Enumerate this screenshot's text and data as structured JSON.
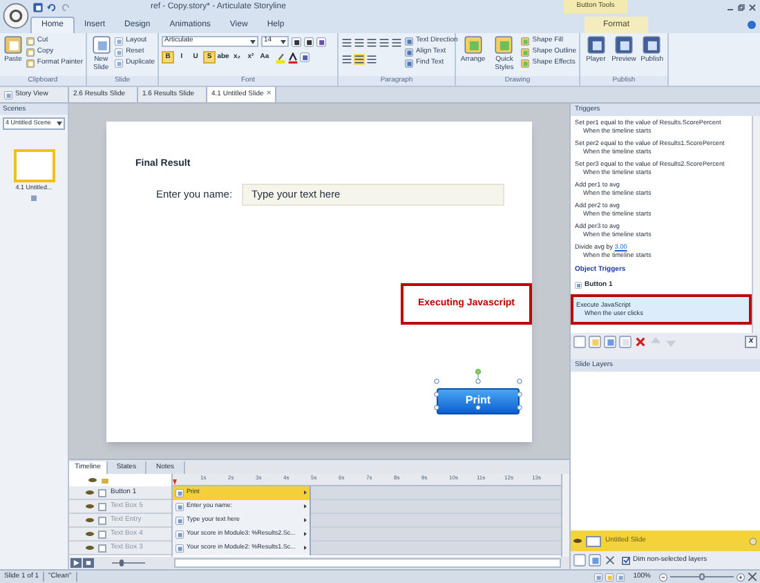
{
  "window": {
    "title": "ref - Copy.story* - Articulate Storyline",
    "context_group": "Button Tools"
  },
  "ribbon_tabs": [
    {
      "label": "Home",
      "selected": true,
      "contextual": false
    },
    {
      "label": "Insert",
      "selected": false,
      "contextual": false
    },
    {
      "label": "Design",
      "selected": false,
      "contextual": false
    },
    {
      "label": "Animations",
      "selected": false,
      "contextual": false
    },
    {
      "label": "View",
      "selected": false,
      "contextual": false
    },
    {
      "label": "Help",
      "selected": false,
      "contextual": false
    },
    {
      "label": "Format",
      "selected": false,
      "contextual": true
    }
  ],
  "ribbon_groups": [
    {
      "label": "Clipboard",
      "kind": "commands",
      "commands": [
        {
          "label": "Paste",
          "kind": "large"
        },
        {
          "label": "Cut",
          "kind": "small"
        },
        {
          "label": "Copy",
          "kind": "small"
        },
        {
          "label": "Format Painter",
          "kind": "small"
        }
      ]
    },
    {
      "label": "Slide",
      "kind": "commands",
      "commands": [
        {
          "label": "New Slide",
          "kind": "large"
        },
        {
          "label": "Layout",
          "kind": "small"
        },
        {
          "label": "Reset",
          "kind": "small"
        },
        {
          "label": "Duplicate",
          "kind": "small"
        }
      ]
    },
    {
      "label": "Font",
      "kind": "font",
      "font_name": "Articulate",
      "font_size": "14",
      "format_buttons": [
        {
          "label": "B",
          "selected": true
        },
        {
          "label": "I",
          "selected": false
        },
        {
          "label": "U",
          "selected": false
        },
        {
          "label": "S",
          "selected": true
        },
        {
          "label": "abe",
          "selected": false
        },
        {
          "label": "x₂",
          "selected": false
        },
        {
          "label": "x²",
          "selected": false
        },
        {
          "label": "Aa",
          "selected": false
        }
      ]
    },
    {
      "label": "Paragraph",
      "kind": "paragraph",
      "commands": [
        {
          "label": "Text Direction",
          "kind": "small"
        },
        {
          "label": "Align Text",
          "kind": "small"
        },
        {
          "label": "Find Text",
          "kind": "small"
        }
      ]
    },
    {
      "label": "Drawing",
      "kind": "commands",
      "commands": [
        {
          "label": "Arrange",
          "kind": "large"
        },
        {
          "label": "Quick Styles",
          "kind": "large"
        },
        {
          "label": "Shape Fill",
          "kind": "small"
        },
        {
          "label": "Shape Outline",
          "kind": "small"
        },
        {
          "label": "Shape Effects",
          "kind": "small"
        }
      ]
    },
    {
      "label": "Publish",
      "kind": "commands",
      "commands": [
        {
          "label": "Player",
          "kind": "large"
        },
        {
          "label": "Preview",
          "kind": "large"
        },
        {
          "label": "Publish",
          "kind": "large"
        }
      ]
    }
  ],
  "document_tabs": [
    {
      "label": "Story View",
      "kind": "story",
      "selected": false
    },
    {
      "label": "2.6 Results Slide",
      "kind": "slide",
      "selected": false
    },
    {
      "label": "1.6 Results Slide",
      "kind": "slide",
      "selected": false
    },
    {
      "label": "4.1 Untitled Slide",
      "kind": "slide",
      "selected": true,
      "close": "×"
    }
  ],
  "scenes": {
    "title": "Scenes",
    "scene": "4 Untitled Scene",
    "slides": [
      {
        "label": "4.1 Untitled...",
        "selected": true
      }
    ]
  },
  "slide": {
    "heading": "Final Result",
    "entry_label": "Enter you name:",
    "entry_text": "Type your text here",
    "button": {
      "label": "Print",
      "selected": true
    }
  },
  "callout": "Executing Javascript",
  "timeline": {
    "tabs": [
      {
        "label": "Timeline",
        "selected": true
      },
      {
        "label": "States",
        "selected": false
      },
      {
        "label": "Notes",
        "selected": false
      }
    ],
    "ruler": [
      "1s",
      "2s",
      "3s",
      "4s",
      "5s",
      "6s",
      "7s",
      "8s",
      "9s",
      "10s",
      "11s",
      "12s",
      "13s"
    ],
    "rows": [
      {
        "name": "Button 1",
        "object": "Print",
        "selected": true,
        "locked": false
      },
      {
        "name": "Text Box 5",
        "object": "Enter you name:",
        "selected": false,
        "locked": false
      },
      {
        "name": "Text Entry",
        "object": "Type your text here",
        "selected": false,
        "locked": false
      },
      {
        "name": "Text Box 4",
        "object": "Your score in Module3: %Results2.Sc...",
        "selected": false,
        "locked": false
      },
      {
        "name": "Text Box 3",
        "object": "Your score in Module2: %Results1.Sc...",
        "selected": false,
        "locked": false
      }
    ],
    "zoom_slider": {
      "level": 0.3
    }
  },
  "triggers": {
    "title": "Triggers",
    "items": [
      {
        "action": "Set per1 equal to the value of Results.ScorePercent",
        "condition": "When the timeline starts"
      },
      {
        "action": "Set per2 equal to the value of Results1.ScorePercent",
        "condition": "When the timeline starts"
      },
      {
        "action": "Set per3 equal to the value of Results2.ScorePercent",
        "condition": "When the timeline starts"
      },
      {
        "action": "Add per1 to avg",
        "condition": "When the timeline starts"
      },
      {
        "action": "Add per2 to avg",
        "condition": "When the timeline starts"
      },
      {
        "action": "Add per3 to avg",
        "condition": "When the timeline starts"
      },
      {
        "action": "Divide avg by",
        "link": "3.00",
        "condition": "When the timeline starts"
      }
    ],
    "object_section": "Object Triggers",
    "object": "Button 1",
    "object_items": [
      {
        "action": "Execute JavaScript",
        "condition": "When the user clicks",
        "selected": true,
        "highlighted": true
      }
    ],
    "variables_button": "x"
  },
  "slide_layers": {
    "title": "Slide Layers",
    "layers": [
      {
        "name": "Untitled Slide",
        "selected": true
      }
    ],
    "dim_label": "Dim non-selected layers",
    "dim_checked": true
  },
  "status_bar": {
    "slide": "Slide 1 of 1",
    "theme": "\"Clean\"",
    "zoom": "100%",
    "zoom_slider": {
      "level": 0.5
    }
  }
}
